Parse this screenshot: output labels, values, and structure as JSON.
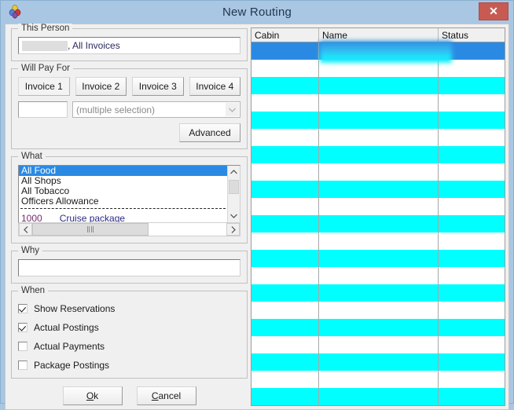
{
  "window": {
    "title": "New Routing",
    "icon": "balloons-icon",
    "close_label": "✕",
    "frame_color": "#a9c6e3",
    "body_color": "#f0f0f0"
  },
  "this_person": {
    "legend": "This Person",
    "value": ", All Invoices",
    "redacted": true
  },
  "will_pay_for": {
    "legend": "Will Pay For",
    "invoice_buttons": [
      {
        "label": "Invoice 1",
        "pressed": true
      },
      {
        "label": "Invoice 2",
        "pressed": false
      },
      {
        "label": "Invoice 3",
        "pressed": false
      },
      {
        "label": "Invoice 4",
        "pressed": false
      }
    ],
    "mini_input_value": "",
    "combo_value": "(multiple selection)",
    "advanced_label": "Advanced"
  },
  "what": {
    "legend": "What",
    "items": [
      {
        "label": "All Food",
        "selected": true,
        "type": "plain"
      },
      {
        "label": "All Shops",
        "selected": false,
        "type": "plain"
      },
      {
        "label": "All Tobacco",
        "selected": false,
        "type": "plain"
      },
      {
        "label": "Officers Allowance",
        "selected": false,
        "type": "plain"
      },
      {
        "label": "",
        "selected": false,
        "type": "separator"
      },
      {
        "label": "1000",
        "desc": "Cruise package",
        "selected": false,
        "type": "code"
      }
    ],
    "vscroll": {
      "up": "∧",
      "down": "∨"
    },
    "hscroll": {
      "left": "‹",
      "right": "›"
    }
  },
  "why": {
    "legend": "Why",
    "value": "",
    "placeholder": ""
  },
  "when": {
    "legend": "When",
    "checkboxes": [
      {
        "label": "Show Reservations",
        "checked": true
      },
      {
        "label": "Actual Postings",
        "checked": true
      },
      {
        "label": "Actual Payments",
        "checked": false
      },
      {
        "label": "Package Postings",
        "checked": false
      }
    ]
  },
  "footer": {
    "ok_label": "Ok",
    "ok_accel": "O",
    "cancel_label": "Cancel",
    "cancel_accel": "C"
  },
  "grid": {
    "columns": [
      "Cabin",
      "Name",
      "Status"
    ],
    "selected_row_color": "#2a8ae3",
    "alt_row_color": "#00ffff",
    "rows": [
      {
        "cabin": "",
        "name": "",
        "status": "",
        "selected": true
      },
      {
        "cabin": "",
        "name": "",
        "status": "",
        "selected": false
      },
      {
        "cabin": "",
        "name": "",
        "status": "",
        "selected": false
      },
      {
        "cabin": "",
        "name": "",
        "status": "",
        "selected": false
      },
      {
        "cabin": "",
        "name": "",
        "status": "",
        "selected": false
      },
      {
        "cabin": "",
        "name": "",
        "status": "",
        "selected": false
      },
      {
        "cabin": "",
        "name": "",
        "status": "",
        "selected": false
      },
      {
        "cabin": "",
        "name": "",
        "status": "",
        "selected": false
      },
      {
        "cabin": "",
        "name": "",
        "status": "",
        "selected": false
      },
      {
        "cabin": "",
        "name": "",
        "status": "",
        "selected": false
      },
      {
        "cabin": "",
        "name": "",
        "status": "",
        "selected": false
      },
      {
        "cabin": "",
        "name": "",
        "status": "",
        "selected": false
      },
      {
        "cabin": "",
        "name": "",
        "status": "",
        "selected": false
      },
      {
        "cabin": "",
        "name": "",
        "status": "",
        "selected": false
      },
      {
        "cabin": "",
        "name": "",
        "status": "",
        "selected": false
      },
      {
        "cabin": "",
        "name": "",
        "status": "",
        "selected": false
      },
      {
        "cabin": "",
        "name": "",
        "status": "",
        "selected": false
      },
      {
        "cabin": "",
        "name": "",
        "status": "",
        "selected": false
      },
      {
        "cabin": "",
        "name": "",
        "status": "",
        "selected": false
      },
      {
        "cabin": "",
        "name": "",
        "status": "",
        "selected": false
      },
      {
        "cabin": "",
        "name": "",
        "status": "",
        "selected": false
      }
    ]
  }
}
